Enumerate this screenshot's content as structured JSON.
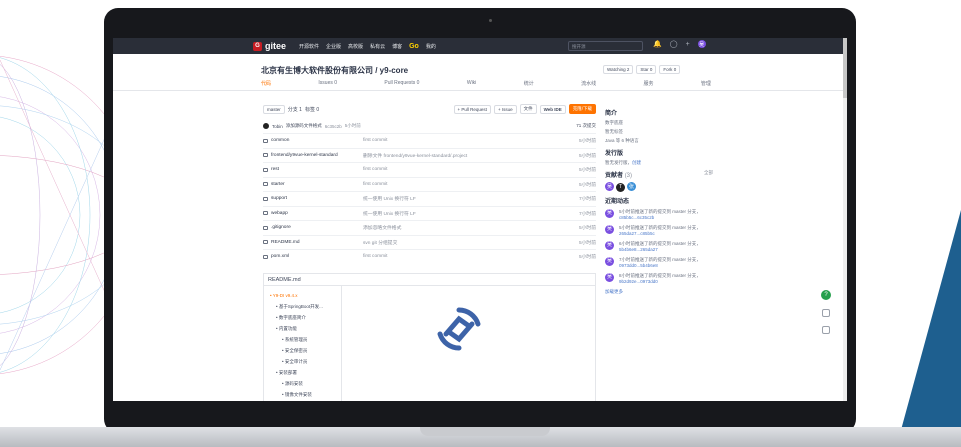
{
  "nav": {
    "brand": "gitee",
    "items": [
      "开源软件",
      "企业版",
      "高校版",
      "私有云",
      "博客"
    ],
    "go": "Go",
    "mine": "我的",
    "search_placeholder": "搜开源"
  },
  "repo": {
    "title": "北京有生博大软件股份有限公司 / y9-core",
    "watch": "Watching",
    "watch_count": "2",
    "star": "Star",
    "star_count": "0",
    "fork": "Fork",
    "fork_count": "0"
  },
  "tabs": [
    "代码",
    "Issues 0",
    "Pull Requests 0",
    "Wiki",
    "统计",
    "流水线",
    "服务",
    "管理"
  ],
  "toolbar": {
    "branch": "master",
    "branches": "分支 1",
    "tags": "标签 0",
    "pr": "+ Pull Request",
    "issue": "+ Issue",
    "file": "文件",
    "webide": "Web IDE",
    "clone": "克隆/下载"
  },
  "commit": {
    "author": "Tobin",
    "message": "添加源码文件格式",
    "hash": "6c35c2b",
    "time": "5小时前",
    "count": "71 次提交"
  },
  "files": [
    {
      "name": "common",
      "msg": "first commit",
      "time": "5小时前"
    },
    {
      "name": "frontend/y9vue-kernel-standard",
      "msg": "删除文件 frontend/y9vue-kernel-standard/.project",
      "time": "5小时前"
    },
    {
      "name": "rest",
      "msg": "first commit",
      "time": "5小时前"
    },
    {
      "name": "starter",
      "msg": "first commit",
      "time": "5小时前"
    },
    {
      "name": "support",
      "msg": "统一使用 Unix 换行符 LF",
      "time": "7小时前"
    },
    {
      "name": "webapp",
      "msg": "统一使用 Unix 换行符 LF",
      "time": "7小时前"
    },
    {
      "name": ".gitignore",
      "msg": "添加忽略文件格式",
      "time": "5小时前"
    },
    {
      "name": "README.md",
      "msg": "svn git 分组提交",
      "time": "5小时前"
    },
    {
      "name": "pom.xml",
      "msg": "first commit",
      "time": "5小时前"
    }
  ],
  "readme": {
    "title": "README.md",
    "toc": [
      "Y9-DI v9.4.x",
      "基于SpringBoot开发...",
      "数字底座简介",
      "内置功能",
      "系统管理员",
      "安全保密员",
      "安全审计员",
      "安装部署",
      "源码安装",
      "镜像文件安装"
    ]
  },
  "side": {
    "intro": "简介",
    "intro_text": "数字底座",
    "no_tags": "暂无标签",
    "lang": "Java 等 6 种语言",
    "release": "发行版",
    "release_text": "暂无发行版，",
    "create": "创建",
    "contrib": "贡献者",
    "contrib_count": "(3)",
    "all": "全部",
    "activity": "近期动态",
    "acts": [
      {
        "t": "5小时前推送了新的提交到 master 分支，",
        "c": "c85b5c...6c35c2b"
      },
      {
        "t": "5小时前推送了新的提交到 master 分支，",
        "c": "265da27...c85b5c"
      },
      {
        "t": "6小时前推送了新的提交到 master 分支，",
        "c": "5b4b6e8...265da27"
      },
      {
        "t": "7小时前推送了新的提交到 master 分支，",
        "c": "0973dd0...5b4b6e8"
      },
      {
        "t": "8小时前推送了新的提交到 master 分支，",
        "c": "9b2d92e...0973dd0"
      }
    ],
    "more": "加载更多"
  },
  "colors": {
    "accent": "#fe7300",
    "nav": "#2a2e38",
    "brand": "#c71d23"
  }
}
